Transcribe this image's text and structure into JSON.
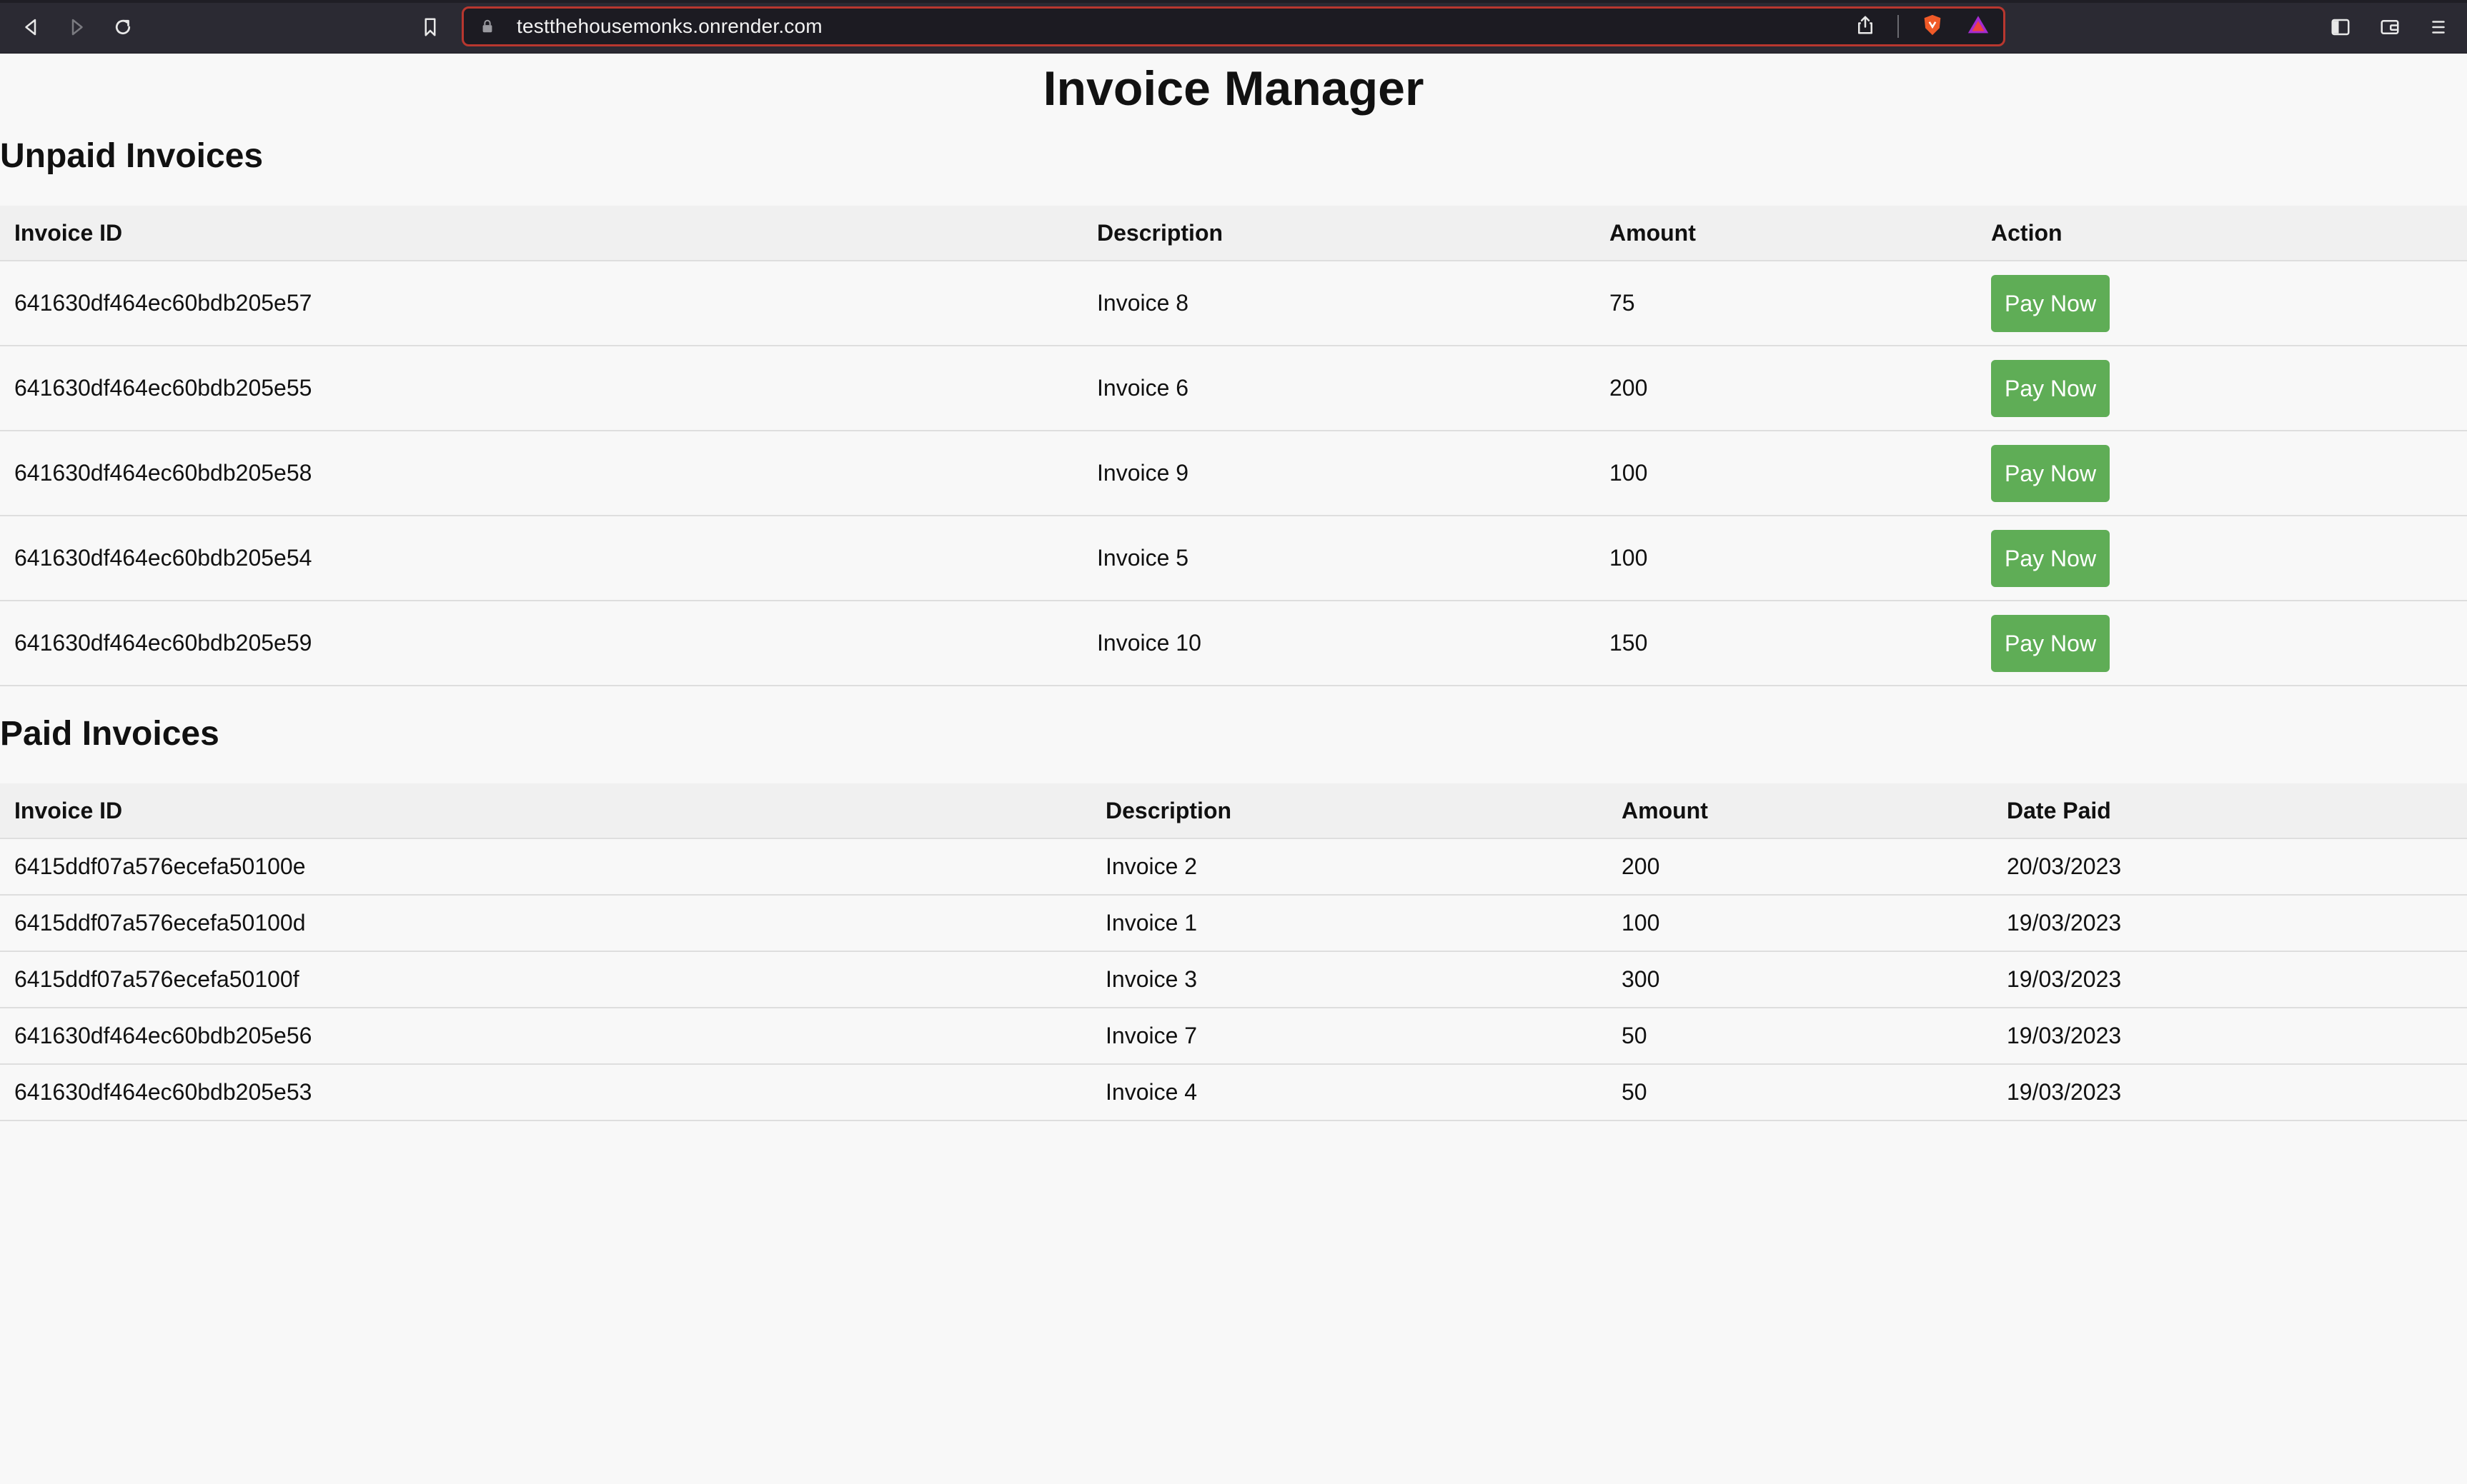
{
  "browser": {
    "url": "testthehousemonks.onrender.com",
    "icons": [
      "back-icon",
      "forward-icon",
      "reload-icon",
      "bookmark-icon",
      "lock-icon",
      "share-icon",
      "brave-shield-icon",
      "brave-rewards-icon",
      "sidebar-icon",
      "wallet-icon",
      "menu-icon"
    ]
  },
  "page": {
    "title": "Invoice Manager"
  },
  "unpaid": {
    "heading": "Unpaid Invoices",
    "columns": [
      "Invoice ID",
      "Description",
      "Amount",
      "Action"
    ],
    "rows": [
      {
        "id": "641630df464ec60bdb205e57",
        "description": "Invoice 8",
        "amount": "75",
        "action": "Pay Now"
      },
      {
        "id": "641630df464ec60bdb205e55",
        "description": "Invoice 6",
        "amount": "200",
        "action": "Pay Now"
      },
      {
        "id": "641630df464ec60bdb205e58",
        "description": "Invoice 9",
        "amount": "100",
        "action": "Pay Now"
      },
      {
        "id": "641630df464ec60bdb205e54",
        "description": "Invoice 5",
        "amount": "100",
        "action": "Pay Now"
      },
      {
        "id": "641630df464ec60bdb205e59",
        "description": "Invoice 10",
        "amount": "150",
        "action": "Pay Now"
      }
    ]
  },
  "paid": {
    "heading": "Paid Invoices",
    "columns": [
      "Invoice ID",
      "Description",
      "Amount",
      "Date Paid"
    ],
    "rows": [
      {
        "id": "6415ddf07a576ecefa50100e",
        "description": "Invoice 2",
        "amount": "200",
        "date_paid": "20/03/2023"
      },
      {
        "id": "6415ddf07a576ecefa50100d",
        "description": "Invoice 1",
        "amount": "100",
        "date_paid": "19/03/2023"
      },
      {
        "id": "6415ddf07a576ecefa50100f",
        "description": "Invoice 3",
        "amount": "300",
        "date_paid": "19/03/2023"
      },
      {
        "id": "641630df464ec60bdb205e56",
        "description": "Invoice 7",
        "amount": "50",
        "date_paid": "19/03/2023"
      },
      {
        "id": "641630df464ec60bdb205e53",
        "description": "Invoice 4",
        "amount": "50",
        "date_paid": "19/03/2023"
      }
    ]
  },
  "colors": {
    "pay_button": "#5fad56",
    "page_background": "#f8f8f8",
    "header_row": "#f0f0f0",
    "chrome": "#2b2a33",
    "url_border": "#b8372f"
  }
}
